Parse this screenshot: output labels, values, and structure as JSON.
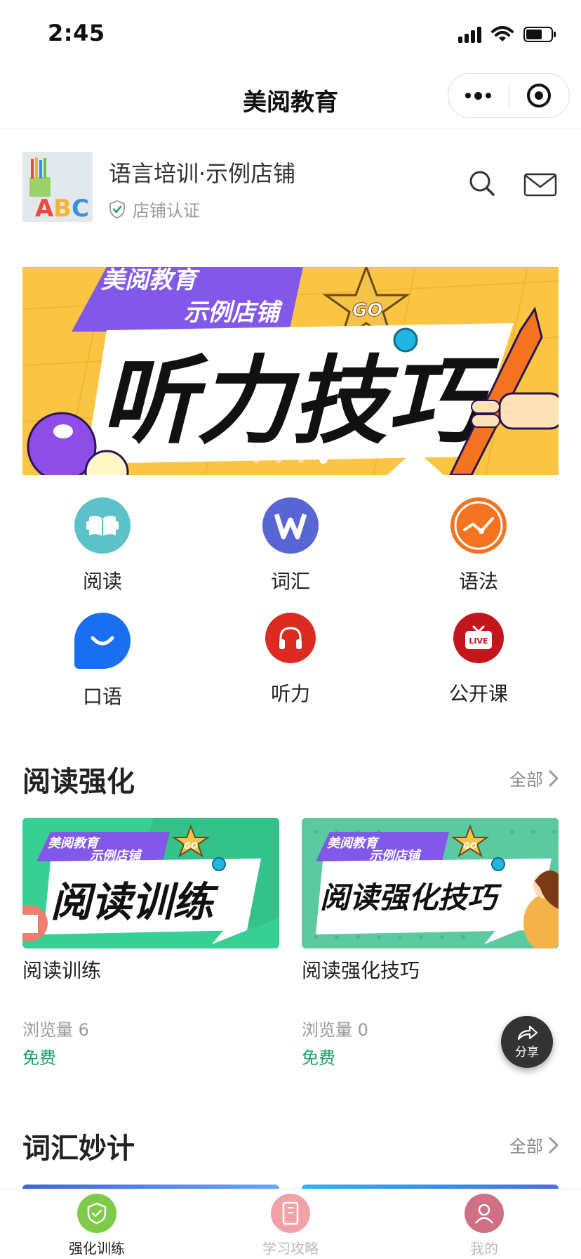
{
  "status_bar": {
    "time": "2:45"
  },
  "nav": {
    "title": "美阅教育"
  },
  "store": {
    "name": "语言培训·示例店铺",
    "verified_label": "店铺认证",
    "logo_letters": "ABC"
  },
  "banner": {
    "brand_line1": "美阅教育",
    "brand_line2": "示例店铺",
    "headline": "听力技巧",
    "badge": "GO",
    "slide_count": 4,
    "active_slide": 4
  },
  "categories": [
    {
      "label": "阅读",
      "icon": "book-icon",
      "color": "#5bc2c9"
    },
    {
      "label": "词汇",
      "icon": "w-letter-icon",
      "color": "#5866d4"
    },
    {
      "label": "语法",
      "icon": "chart-line-icon",
      "color": "#f47320"
    },
    {
      "label": "口语",
      "icon": "chat-bubble-icon",
      "color": "#1a6ff0"
    },
    {
      "label": "听力",
      "icon": "headphones-icon",
      "color": "#db2a20"
    },
    {
      "label": "公开课",
      "icon": "live-tv-icon",
      "color": "#c3161c"
    }
  ],
  "sections": [
    {
      "title": "阅读强化",
      "more_label": "全部",
      "cards": [
        {
          "title": "阅读训练",
          "image_text": "阅读训练",
          "brand_line1": "美阅教育",
          "brand_line2": "示例店铺",
          "badge": "GO",
          "views": "浏览量 6",
          "price": "免费",
          "bg": "#38cf94"
        },
        {
          "title": "阅读强化技巧",
          "image_text": "阅读强化技巧",
          "brand_line1": "美阅教育",
          "brand_line2": "示例店铺",
          "badge": "GO",
          "views": "浏览量 0",
          "price": "免费",
          "bg": "#5ccaa0"
        }
      ]
    },
    {
      "title": "词汇妙计",
      "more_label": "全部"
    }
  ],
  "share_fab": {
    "label": "分享"
  },
  "tabbar": [
    {
      "label": "强化训练",
      "icon": "shield-icon",
      "active": true,
      "color": "#7ccc4a"
    },
    {
      "label": "学习攻略",
      "icon": "phone-book-icon",
      "active": false,
      "color": "#f0a2a8"
    },
    {
      "label": "我的",
      "icon": "user-icon",
      "active": false,
      "color": "#cf7084"
    }
  ]
}
